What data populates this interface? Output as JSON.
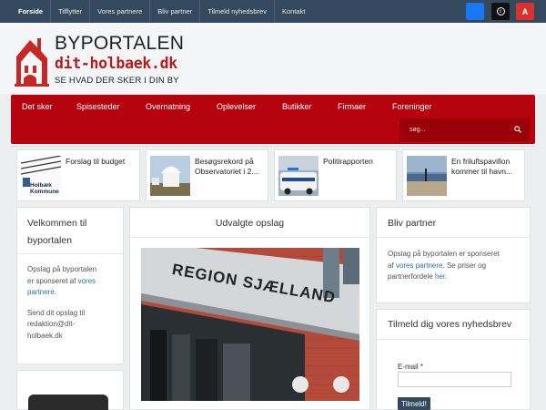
{
  "topbar": {
    "nav": [
      "Forside",
      "Tilflytter",
      "Vores partnere",
      "Bliv partner",
      "Tilmeld nyhedsbrev",
      "Kontakt"
    ],
    "social_icons": [
      "facebook-icon",
      "instagram-icon",
      "a-icon"
    ],
    "social_a_label": "A",
    "instagram_glyph": "i"
  },
  "brand": {
    "line1": "BYPORTALEN",
    "line2": "dit-holbaek.dk",
    "line3": "SE HVAD DER SKER I DIN BY",
    "accent": "#b71c1c"
  },
  "mainnav": {
    "items": [
      "Det sker",
      "Spisesteder",
      "Overnatning",
      "Oplevelser",
      "Butikker",
      "Firmaer",
      "Foreninger"
    ],
    "search_placeholder": "søg...",
    "color": "#b5040e"
  },
  "news": [
    {
      "title": "Forslag til budget",
      "thumb_text": "Holbæk Kommune"
    },
    {
      "title": "Besøgsrekord på Observatoriet i 2..."
    },
    {
      "title": "Politirapporten"
    },
    {
      "title": "En friluftspavillon kommer til havn..."
    }
  ],
  "welcome": {
    "title_line1": "Velkommen til",
    "title_line2": "byportalen",
    "p1_line1": "Opslag på byportalen",
    "p1_line2a": "er sponseret af ",
    "p1_link1": "vores",
    "p1_link2": "partnere",
    "p1_end": ".",
    "p2_line1": "Send dit opslag til",
    "p2_line2": "redaktion@dit-",
    "p2_line3": "holbaek.dk"
  },
  "featured": {
    "title": "Udvalgte opslag",
    "sign_text": "REGION SJÆLLAND"
  },
  "partner": {
    "title": "Bliv partner",
    "line1": "Opslag på byportalen er sponseret",
    "line2a": "af ",
    "link1": "vores partnere",
    "line2b": ". Se priser og",
    "line3a": "partnerfordele ",
    "link2": "her",
    "line3b": "."
  },
  "newsletter": {
    "title": "Tilmeld dig vores nyhedsbrev",
    "email_label": "E-mail *",
    "button": "Tilmeld!"
  }
}
